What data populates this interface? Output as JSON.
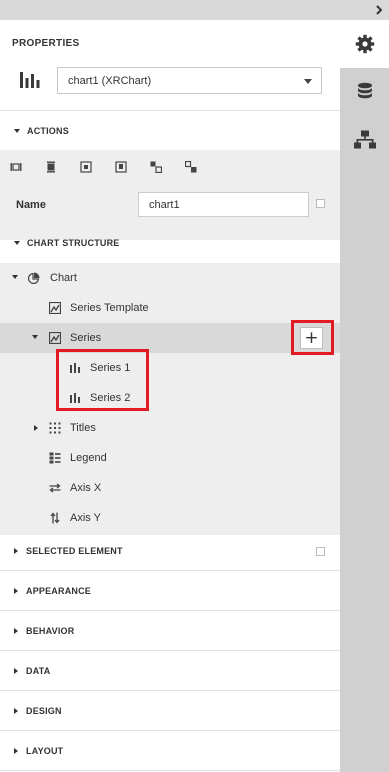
{
  "header": {
    "title": "PROPERTIES"
  },
  "component_select": {
    "value": "chart1 (XRChart)"
  },
  "actions": {
    "title": "ACTIONS",
    "icons": [
      "align-left-icon",
      "align-center-icon",
      "bring-to-front-icon",
      "send-to-back-icon",
      "fit-to-container-icon",
      "size-to-grid-icon"
    ]
  },
  "name_field": {
    "label": "Name",
    "value": "chart1"
  },
  "chart_structure": {
    "title": "CHART STRUCTURE",
    "tree": [
      {
        "label": "Chart",
        "icon": "chart-pie-icon"
      },
      {
        "label": "Series Template",
        "icon": "series-template-icon"
      },
      {
        "label": "Series",
        "icon": "series-icon",
        "add_button": "+"
      },
      {
        "label": "Series 1",
        "icon": "bar-series-icon"
      },
      {
        "label": "Series 2",
        "icon": "bar-series-icon"
      },
      {
        "label": "Titles",
        "icon": "titles-icon"
      },
      {
        "label": "Legend",
        "icon": "legend-icon"
      },
      {
        "label": "Axis X",
        "icon": "axis-x-icon"
      },
      {
        "label": "Axis Y",
        "icon": "axis-y-icon"
      }
    ]
  },
  "sections": [
    {
      "title": "SELECTED ELEMENT"
    },
    {
      "title": "APPEARANCE"
    },
    {
      "title": "BEHAVIOR"
    },
    {
      "title": "DATA"
    },
    {
      "title": "DESIGN"
    },
    {
      "title": "LAYOUT"
    }
  ],
  "rail": {
    "tabs": [
      "gear-icon",
      "database-icon",
      "hierarchy-icon"
    ]
  },
  "colors": {
    "highlight": "#e01b24",
    "rail": "#d0d0d0",
    "selected_row": "#d9d9d9",
    "section_bg": "#eeeeee"
  }
}
